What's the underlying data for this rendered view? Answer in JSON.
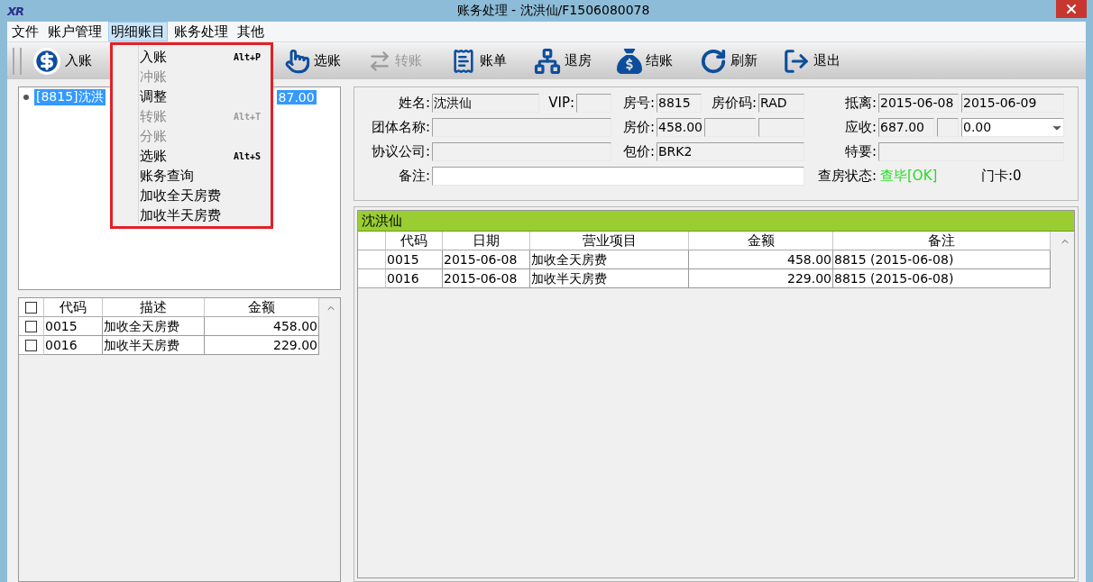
{
  "window": {
    "logo": "XR",
    "title": "账务处理 - 沈洪仙/F1506080078"
  },
  "menu_bar": [
    {
      "label": "文件",
      "selected": false
    },
    {
      "label": "账户管理",
      "selected": false
    },
    {
      "label": "明细账目",
      "selected": true
    },
    {
      "label": "账务处理",
      "selected": false
    },
    {
      "label": "其他",
      "selected": false
    }
  ],
  "open_menu": {
    "items": [
      {
        "label": "入账",
        "shortcut": "Alt+P",
        "disabled": false
      },
      {
        "label": "冲账",
        "disabled": true
      },
      {
        "label": "调整",
        "disabled": false
      },
      {
        "label": "转账",
        "shortcut": "Alt+T",
        "disabled": true
      },
      {
        "label": "分账",
        "disabled": true
      },
      {
        "label": "选账",
        "shortcut": "Alt+S",
        "disabled": false
      },
      {
        "label": "账务查询",
        "disabled": false
      },
      {
        "label": "加收全天房费",
        "disabled": false
      },
      {
        "label": "加收半天房费",
        "disabled": false
      }
    ]
  },
  "toolbar": [
    {
      "label": "入账",
      "kind": "dollar",
      "disabled": false
    },
    {
      "label": "选账",
      "kind": "hand",
      "disabled": false
    },
    {
      "label": "转账",
      "kind": "transfer",
      "disabled": true
    },
    {
      "label": "账单",
      "kind": "bill",
      "disabled": false
    },
    {
      "label": "退房",
      "kind": "checkout",
      "disabled": false
    },
    {
      "label": "结账",
      "kind": "bag",
      "disabled": false
    },
    {
      "label": "刷新",
      "kind": "refresh",
      "disabled": false
    },
    {
      "label": "退出",
      "kind": "exit",
      "disabled": false
    }
  ],
  "account_tree": {
    "item": {
      "label_start": "[8815]沈洪",
      "label_end": "87.00",
      "selected": true
    }
  },
  "charge_table": {
    "all_checked": false,
    "columns": [
      "代码",
      "描述",
      "金额"
    ],
    "rows": [
      {
        "checked": false,
        "code": "0015",
        "description": "加收全天房费",
        "amount": "458.00"
      },
      {
        "checked": false,
        "code": "0016",
        "description": "加收半天房费",
        "amount": "229.00"
      }
    ]
  },
  "guest_info": {
    "name": {
      "label": "姓名:",
      "value": "沈洪仙"
    },
    "vip": {
      "label": "VIP:"
    },
    "room": {
      "label": "房号:",
      "value": "8815"
    },
    "rate_code": {
      "label": "房价码:",
      "value": "RAD"
    },
    "stay": {
      "label": "抵离:",
      "arrival": "2015-06-08",
      "departure": "2015-06-09"
    },
    "group": {
      "label": "团体名称:"
    },
    "room_rate": {
      "label": "房价:",
      "value": "458.00"
    },
    "receivable": {
      "label": "应收:",
      "value": "687.00",
      "select": "0.00"
    },
    "company": {
      "label": "协议公司:"
    },
    "package": {
      "label": "包价:",
      "value": "BRK2"
    },
    "special": {
      "label": "特要:"
    },
    "remark": {
      "label": "备注:"
    },
    "inspection": {
      "label": "查房状态:",
      "value": "查毕[OK]"
    },
    "card": {
      "label": "门卡:",
      "value": "0"
    }
  },
  "ledger": {
    "title": "沈洪仙",
    "columns": [
      "代码",
      "日期",
      "营业项目",
      "金额",
      "备注"
    ],
    "rows": [
      {
        "code": "0015",
        "date": "2015-06-08",
        "item": "加收全天房费",
        "amount": "458.00",
        "note": "8815 (2015-06-08)"
      },
      {
        "code": "0016",
        "date": "2015-06-08",
        "item": "加收半天房费",
        "amount": "229.00",
        "note": "8815 (2015-06-08)"
      }
    ]
  }
}
